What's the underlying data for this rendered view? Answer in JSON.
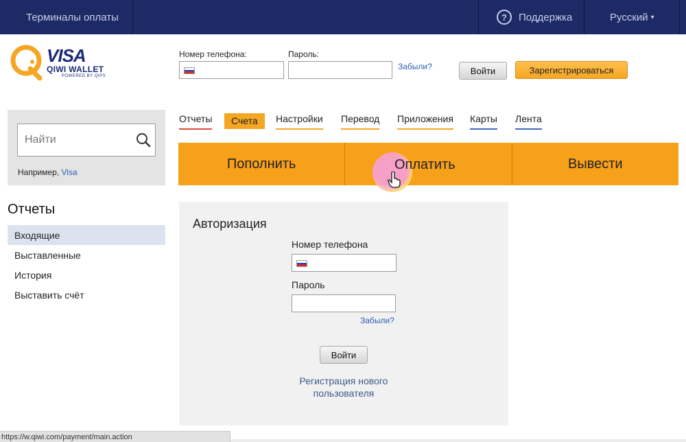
{
  "topbar": {
    "terminals": "Терминалы оплаты",
    "support": "Поддержка",
    "help_glyph": "?",
    "language": "Русский",
    "caret": "▾"
  },
  "logo": {
    "visa": "VISA",
    "wallet": "QIWI WALLET",
    "powered": "POWERED BY QIPS"
  },
  "header_login": {
    "phone_label": "Номер телефона:",
    "password_label": "Пароль:",
    "forgot": "Забыли?",
    "login_button": "Войти",
    "register_button": "Зарегистрироваться"
  },
  "search": {
    "placeholder": "Найти",
    "example_prefix": "Например,",
    "example_link": "Visa"
  },
  "sidebar": {
    "title": "Отчеты",
    "items": [
      {
        "label": "Входящие",
        "active": true
      },
      {
        "label": "Выставленные",
        "active": false
      },
      {
        "label": "История",
        "active": false
      },
      {
        "label": "Выставить счёт",
        "active": false
      }
    ]
  },
  "nav": {
    "items": [
      {
        "label": "Отчеты",
        "underline": "red"
      },
      {
        "label": "Счета",
        "active": true
      },
      {
        "label": "Настройки",
        "underline": "orange"
      },
      {
        "label": "Перевод",
        "underline": "orange"
      },
      {
        "label": "Приложения",
        "underline": "orange"
      },
      {
        "label": "Карты",
        "underline": "blue"
      },
      {
        "label": "Лента",
        "underline": "blue"
      }
    ]
  },
  "actions": {
    "topup": "Пополнить",
    "pay": "Оплатить",
    "withdraw": "Вывести"
  },
  "auth": {
    "title": "Авторизация",
    "phone_label": "Номер телефона",
    "password_label": "Пароль",
    "forgot": "Забыли?",
    "login_button": "Войти",
    "register_line1": "Регистрация нового",
    "register_line2": "пользователя"
  },
  "status_url": "https://w.qiwi.com/payment/main.action",
  "colors": {
    "topbar": "#1e2a66",
    "accent_orange": "#f7a01a",
    "link_blue": "#2a5db0"
  }
}
